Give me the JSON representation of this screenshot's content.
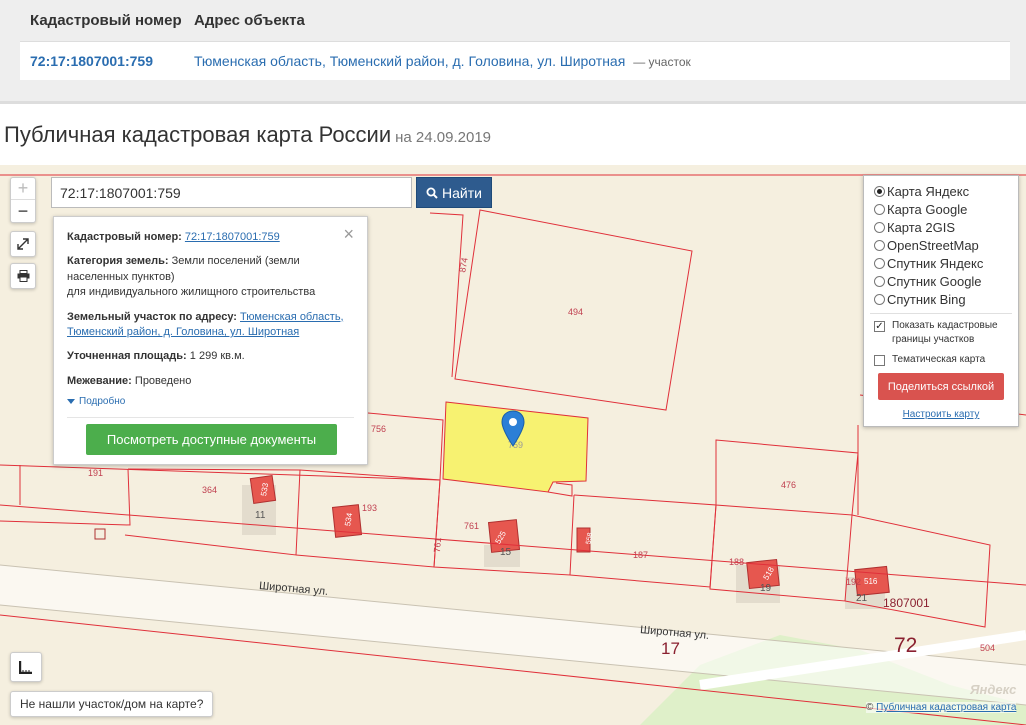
{
  "results": {
    "headers": [
      "Кадастровый номер",
      "Адрес объекта"
    ],
    "rows": [
      {
        "number": "72:17:1807001:759",
        "address": "Тюменская область, Тюменский район, д. Головина, ул. Широтная",
        "kind": "— участок"
      }
    ]
  },
  "page": {
    "title": "Публичная кадастровая карта России",
    "date": "на 24.09.2019"
  },
  "map": {
    "zoom_in": "+",
    "zoom_out": "−",
    "search": {
      "value": "72:17:1807001:759",
      "button": "Найти"
    },
    "info": {
      "cad_label": "Кадастровый номер:",
      "cad_value": "72:17:1807001:759",
      "category_label": "Категория земель:",
      "category_value": "Земли поселений (земли населенных пунктов)",
      "category_sub": "для индивидуального жилищного строительства",
      "address_label": "Земельный участок по адресу:",
      "address_value": "Тюменская область, Тюменский район, д. Головина, ул. Широтная",
      "area_label": "Уточненная площадь:",
      "area_value": "1 299 кв.м.",
      "survey_label": "Межевание:",
      "survey_value": "Проведено",
      "more": "Подробно",
      "docs_button": "Посмотреть доступные документы",
      "close": "×"
    },
    "layers": {
      "options": [
        "Карта Яндекс",
        "Карта Google",
        "Карта 2GIS",
        "OpenStreetMap",
        "Спутник Яндекс",
        "Спутник Google",
        "Спутник Bing"
      ],
      "selected": 0,
      "show_borders": "Показать кадастровые границы участков",
      "show_borders_checked": true,
      "thematic": "Тематическая карта",
      "thematic_checked": false,
      "share": "Поделиться ссылкой",
      "setup": "Настроить карту"
    },
    "labels": {
      "street1": "Широтная ул.",
      "street2": "Широтная ул.",
      "house_17": "17",
      "region_72": "72",
      "quarter": "1807001",
      "parcels": [
        "874",
        "494",
        "756",
        "759",
        "191",
        "364",
        "193",
        "761",
        "761",
        "187",
        "476",
        "188",
        "192",
        "11",
        "15",
        "19",
        "21",
        "533",
        "534",
        "525",
        "516",
        "518",
        "558",
        "504"
      ]
    },
    "not_found": "Не нашли участок/дом на карте?",
    "attribution": {
      "prefix": "©",
      "link": "Публичная кадастровая карта"
    },
    "provider_mark": "Яндекс",
    "colors": {
      "parcel_border": "#e0303a",
      "selected_fill": "#f7f25e",
      "building": "#d9534f",
      "accent": "#2a6db0"
    }
  }
}
